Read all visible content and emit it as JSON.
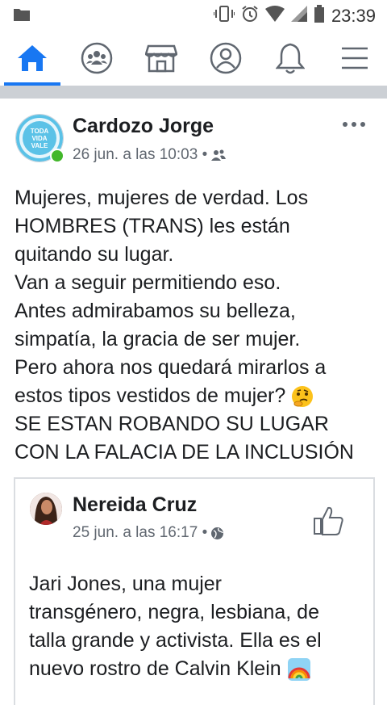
{
  "status_bar": {
    "time": "23:39"
  },
  "nav": {
    "items": [
      {
        "name": "home",
        "active": true
      },
      {
        "name": "groups"
      },
      {
        "name": "marketplace"
      },
      {
        "name": "profile"
      },
      {
        "name": "notifications"
      },
      {
        "name": "menu"
      }
    ]
  },
  "post": {
    "author": "Cardozo Jorge",
    "avatar_text": [
      "TODA",
      "VIDA",
      "VALE"
    ],
    "timestamp": "26 jun. a las 10:03 •",
    "text_lines": [
      "Mujeres, mujeres de verdad. Los",
      "HOMBRES (TRANS) les están",
      "quitando su lugar.",
      "Van a seguir permitiendo eso.",
      "Antes admirabamos su belleza,",
      "simpatía, la gracia de ser mujer.",
      "Pero ahora nos quedará mirarlos a",
      "estos tipos vestidos de mujer?",
      "SE ESTAN ROBANDO SU LUGAR",
      "CON LA FALACIA DE LA INCLUSIÓN"
    ]
  },
  "shared_post": {
    "author": "Nereida Cruz",
    "timestamp": "25 jun. a las 16:17 •",
    "text_lines": [
      "Jari Jones, una mujer",
      "transgénero, negra, lesbiana, de",
      "talla grande y activista. Ella es el",
      "nuevo rostro de Calvin Klein"
    ]
  },
  "colors": {
    "accent": "#1877f2",
    "online": "#42b72a",
    "divider": "#ccd0d5"
  }
}
